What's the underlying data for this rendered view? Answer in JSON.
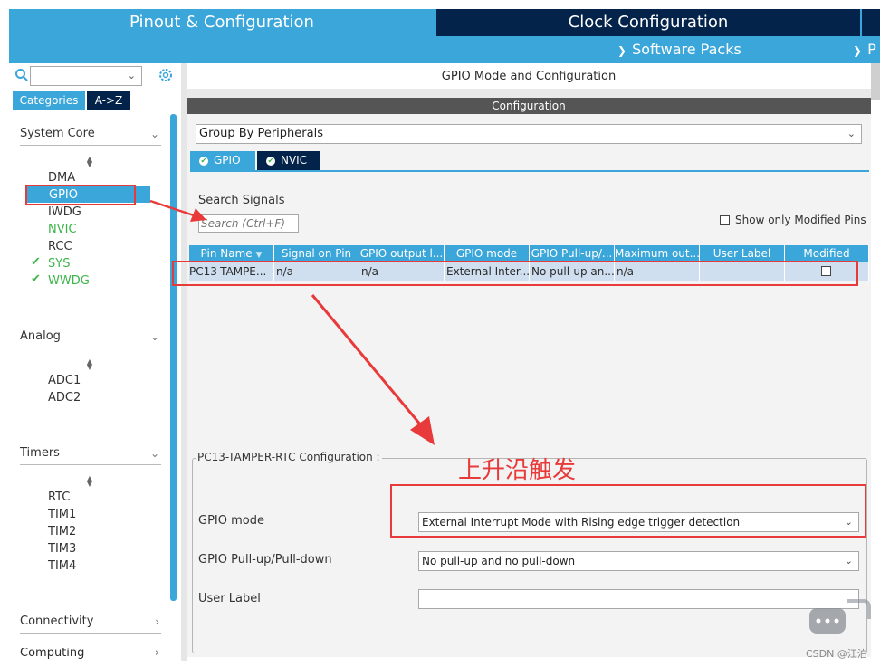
{
  "top_tabs": {
    "pinout": "Pinout & Configuration",
    "clock": "Clock Configuration",
    "software_packs": "Software Packs",
    "partial_tab": "P"
  },
  "left": {
    "tabs": [
      "Categories",
      "A->Z"
    ],
    "groups": {
      "system_core": {
        "label": "System Core",
        "items": [
          "DMA",
          "GPIO",
          "IWDG",
          "NVIC",
          "RCC",
          "SYS",
          "WWDG"
        ]
      },
      "analog": {
        "label": "Analog",
        "items": [
          "ADC1",
          "ADC2"
        ]
      },
      "timers": {
        "label": "Timers",
        "items": [
          "RTC",
          "TIM1",
          "TIM2",
          "TIM3",
          "TIM4"
        ]
      },
      "connectivity": {
        "label": "Connectivity"
      },
      "computing": {
        "label": "Computing"
      }
    }
  },
  "main": {
    "title": "GPIO Mode and Configuration",
    "config_header": "Configuration",
    "group_by": "Group By Peripherals",
    "tabs": [
      "GPIO",
      "NVIC"
    ],
    "search_label": "Search Signals",
    "search_placeholder": "Search (Ctrl+F)",
    "show_modified": "Show only Modified Pins",
    "table": {
      "headers": [
        "Pin Name",
        "Signal on Pin",
        "GPIO output l...",
        "GPIO mode",
        "GPIO Pull-up/...",
        "Maximum out...",
        "User Label",
        "Modified"
      ],
      "row": [
        "PC13-TAMPE...",
        "n/a",
        "n/a",
        "External Inter...",
        "No pull-up an...",
        "n/a",
        "",
        ""
      ]
    },
    "pin_config": {
      "legend": "PC13-TAMPER-RTC Configuration :",
      "gpio_mode_label": "GPIO mode",
      "gpio_mode_value": "External Interrupt Mode with Rising edge trigger detection",
      "pull_label": "GPIO Pull-up/Pull-down",
      "pull_value": "No pull-up and no pull-down",
      "user_label": "User Label",
      "user_label_value": ""
    }
  },
  "annotation": "上升沿触发",
  "watermark": "CSDN @江泊",
  "colors": {
    "accent": "#3aa6d9",
    "dark_navy": "#03234b",
    "green": "#3cb44a",
    "annotation_red": "#e83a3a"
  }
}
